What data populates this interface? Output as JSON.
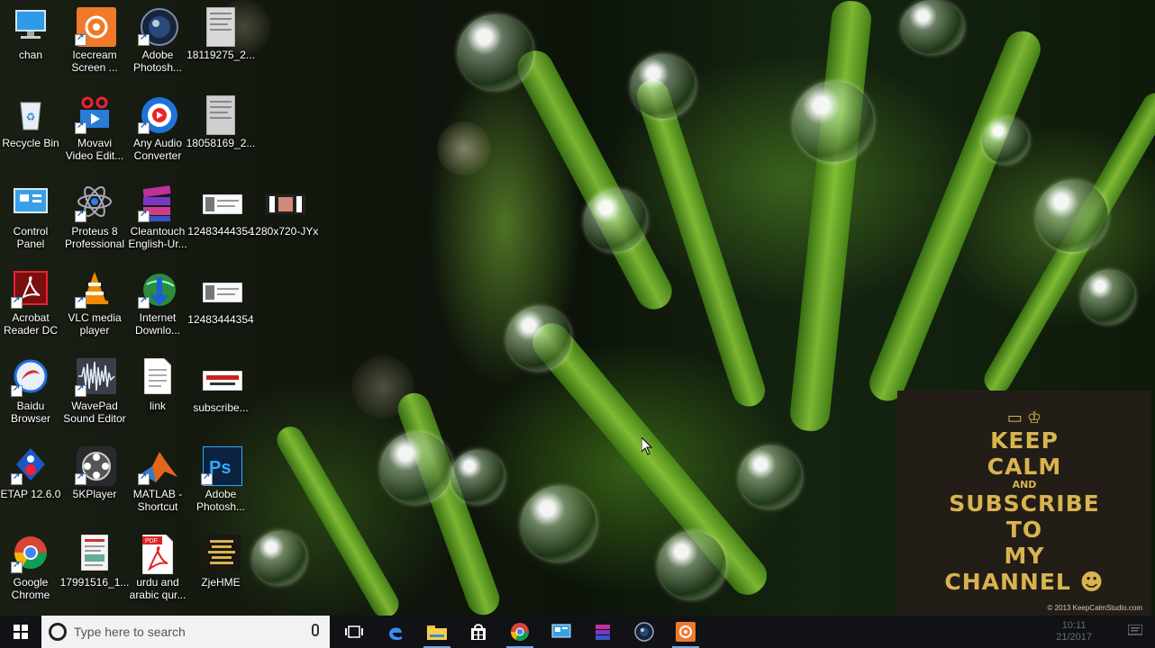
{
  "desktop": {
    "icons": [
      {
        "label": "chan",
        "icon": "computer-icon"
      },
      {
        "label": "Icecream\nScreen ...",
        "icon": "icecream-recorder-icon"
      },
      {
        "label": "Adobe\nPhotosh...",
        "icon": "adobe-photoshop-lens-icon"
      },
      {
        "label": "18119275_2...",
        "icon": "document-thumbnail-icon"
      },
      {
        "label": "Recycle Bin",
        "icon": "recycle-bin-icon"
      },
      {
        "label": "Movavi\nVideo Edit...",
        "icon": "movavi-icon"
      },
      {
        "label": "Any Audio\nConverter",
        "icon": "audio-converter-icon"
      },
      {
        "label": "18058169_2...",
        "icon": "document-thumbnail-icon"
      },
      {
        "label": "Control\nPanel",
        "icon": "control-panel-icon"
      },
      {
        "label": "Proteus 8\nProfessional",
        "icon": "proteus-atom-icon"
      },
      {
        "label": "Cleantouch\nEnglish-Ur...",
        "icon": "books-icon"
      },
      {
        "label": "12483444354",
        "icon": "image-thumbnail-icon"
      },
      {
        "label": "1280x720-JYx",
        "icon": "video-thumbnail-icon"
      },
      {
        "label": "Acrobat\nReader DC",
        "icon": "acrobat-icon"
      },
      {
        "label": "VLC media\nplayer",
        "icon": "vlc-cone-icon"
      },
      {
        "label": "Internet\nDownlo...",
        "icon": "idm-globe-icon"
      },
      {
        "label": "12483444354",
        "icon": "image-thumbnail-icon"
      },
      {
        "label": "Baidu\nBrowser",
        "icon": "baidu-browser-icon"
      },
      {
        "label": "WavePad\nSound Editor",
        "icon": "waveform-icon"
      },
      {
        "label": "link",
        "icon": "text-file-icon"
      },
      {
        "label": "subscribe...",
        "icon": "subscribe-image-icon"
      },
      {
        "label": "ETAP 12.6.0",
        "icon": "etap-icon"
      },
      {
        "label": "5KPlayer",
        "icon": "film-reel-icon"
      },
      {
        "label": "MATLAB -\nShortcut",
        "icon": "matlab-icon"
      },
      {
        "label": "Adobe\nPhotosh...",
        "icon": "photoshop-ps-icon"
      },
      {
        "label": "Google\nChrome",
        "icon": "chrome-icon"
      },
      {
        "label": "17991516_1...",
        "icon": "document-thumbnail-icon"
      },
      {
        "label": "urdu and\narabic qur...",
        "icon": "pdf-icon"
      },
      {
        "label": "ZjeHME",
        "icon": "keep-calm-thumbnail-icon"
      }
    ]
  },
  "poster": {
    "line1": "KEEP",
    "line2": "CALM",
    "line3": "AND",
    "line4": "SUBSCRIBE",
    "line5": "TO",
    "line6": "MY",
    "line7": "CHANNEL ☻",
    "footer": "© 2013 KeepCalmStudio.com"
  },
  "taskbar": {
    "search_placeholder": "Type here to search",
    "apps": [
      "task-view-icon",
      "edge-icon",
      "file-explorer-icon",
      "store-icon",
      "chrome-icon",
      "control-panel-icon",
      "books-icon",
      "photoshop-lens-icon",
      "icecream-recorder-icon"
    ],
    "clock_time": "10:11",
    "clock_date": "21/2017"
  },
  "colors": {
    "taskbar": "#101216",
    "poster_bg": "#231d17",
    "poster_text": "#d8b44e"
  }
}
